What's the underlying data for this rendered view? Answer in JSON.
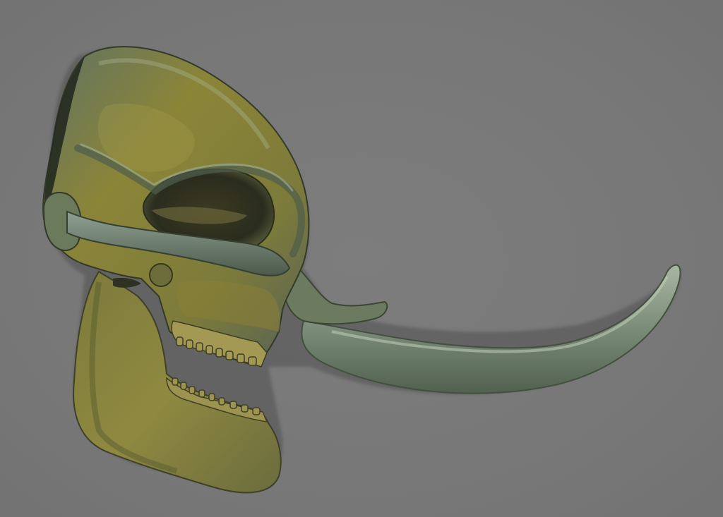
{
  "viewport": {
    "background_color": "#7a7a7a",
    "subject": "skull-3d-render"
  },
  "colors": {
    "bone_ochre": "#8a8236",
    "bone_green": "#6f7e62",
    "tusk_gray_green": "#7e8f7d",
    "shadow": "#2b2f22",
    "highlight": "#c9c98a"
  }
}
